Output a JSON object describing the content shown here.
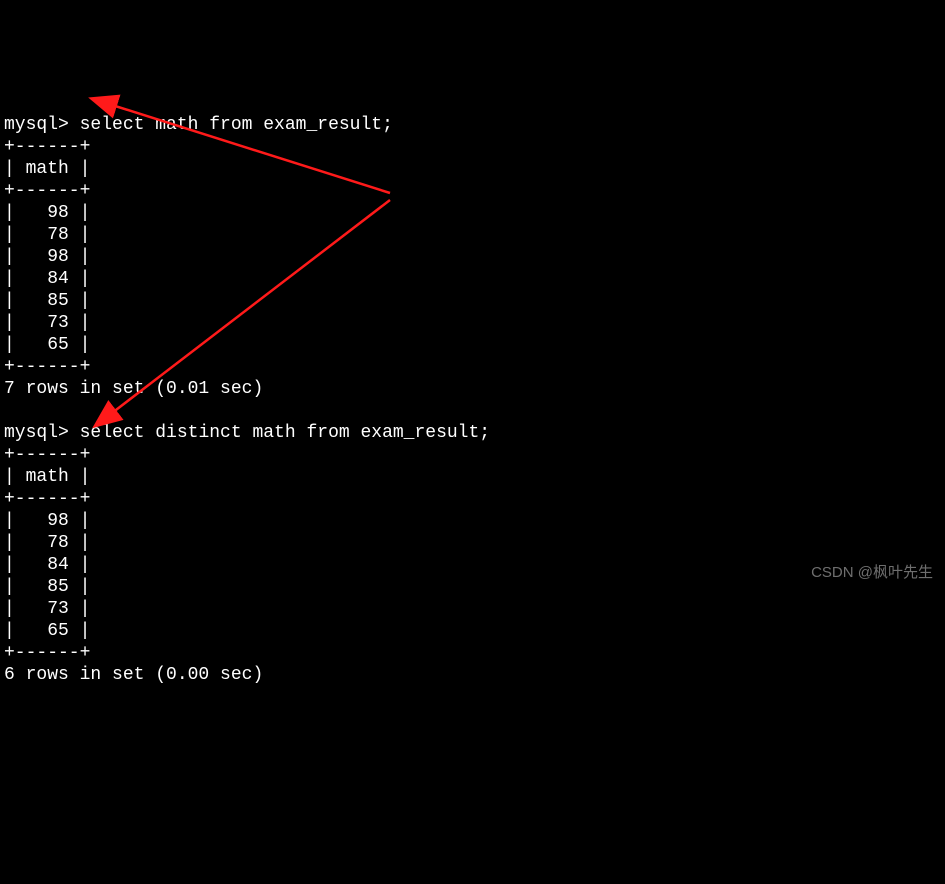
{
  "query1": {
    "prompt": "mysql> ",
    "sql": "select math from exam_result;",
    "divider": "+------+",
    "header_row": "| math |",
    "rows": [
      "|   98 |",
      "|   78 |",
      "|   98 |",
      "|   84 |",
      "|   85 |",
      "|   73 |",
      "|   65 |"
    ],
    "footer": "7 rows in set (0.01 sec)"
  },
  "query2": {
    "prompt": "mysql> ",
    "sql": "select distinct math from exam_result;",
    "divider": "+------+",
    "header_row": "| math |",
    "rows": [
      "|   98 |",
      "|   78 |",
      "|   84 |",
      "|   85 |",
      "|   73 |",
      "|   65 |"
    ],
    "footer": "6 rows in set (0.00 sec)"
  },
  "watermark": "CSDN @枫叶先生",
  "chart_data": {
    "type": "table",
    "description": "MySQL terminal output comparing SELECT vs SELECT DISTINCT on math column",
    "tables": [
      {
        "query": "select math from exam_result;",
        "columns": [
          "math"
        ],
        "rows": [
          [
            98
          ],
          [
            78
          ],
          [
            98
          ],
          [
            84
          ],
          [
            85
          ],
          [
            73
          ],
          [
            65
          ]
        ],
        "row_count": 7,
        "elapsed_sec": 0.01
      },
      {
        "query": "select distinct math from exam_result;",
        "columns": [
          "math"
        ],
        "rows": [
          [
            98
          ],
          [
            78
          ],
          [
            84
          ],
          [
            85
          ],
          [
            73
          ],
          [
            65
          ]
        ],
        "row_count": 6,
        "elapsed_sec": 0.0
      }
    ],
    "annotations": "Red arrows highlight the row value 98, showing the duplicate removed by DISTINCT"
  }
}
